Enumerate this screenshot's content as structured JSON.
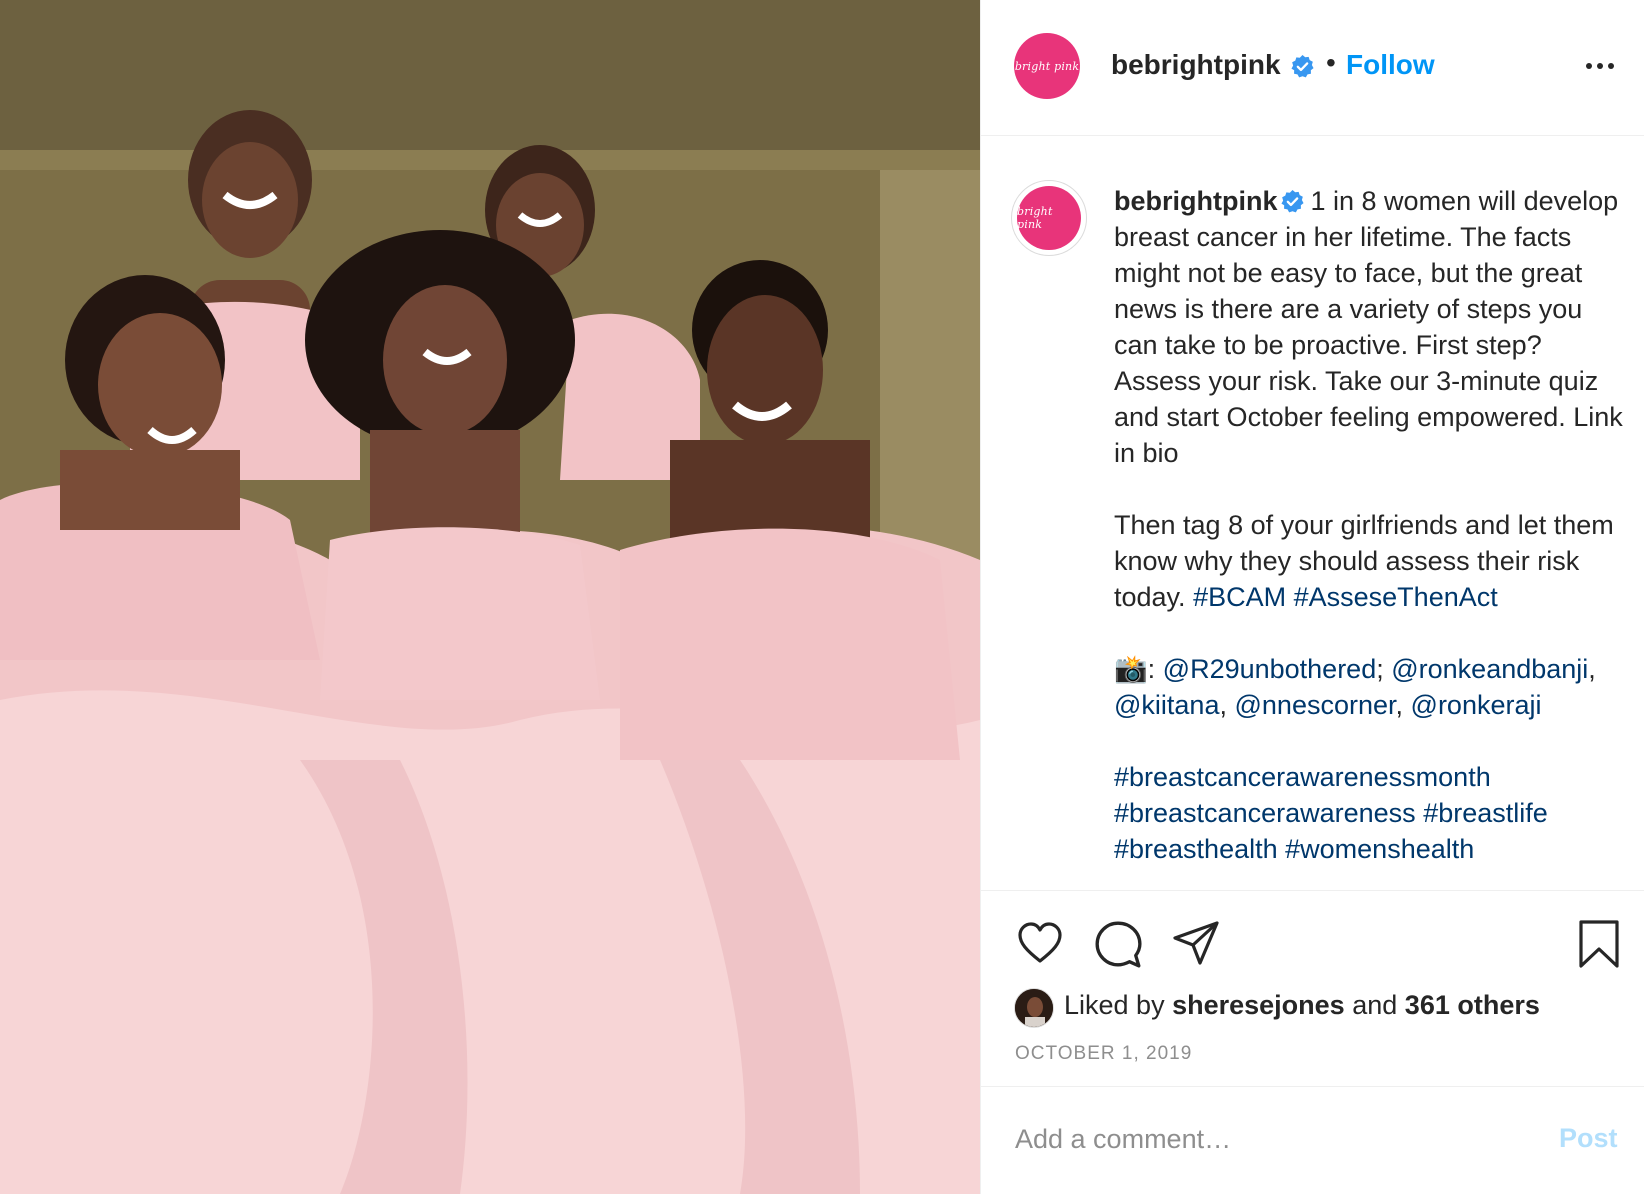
{
  "photo": {
    "alt_icon": "photo-image"
  },
  "header": {
    "avatar_text": "bright pink",
    "username": "bebrightpink",
    "separator": "•",
    "follow_label": "Follow",
    "more_icon": "more-options-icon"
  },
  "caption": {
    "avatar_text": "bright pink",
    "username": "bebrightpink",
    "paragraph1": "1 in 8 women will develop breast cancer in her lifetime. The facts might not be easy to face, but the great news is there are a variety of steps you can take to be proactive. First step? Assess your risk. Take our 3-minute quiz and start October feeling empowered. Link in bio",
    "paragraph2": "Then tag 8 of your girlfriends and let them know why they should assess their risk today.",
    "hashtag_bcam": "#BCAM",
    "hashtag_assess": "#AsseseThenAct",
    "camera_emoji": "📸",
    "credit_colon": ":",
    "mention1": "@R29unbothered",
    "mention_sep1": ";",
    "mention2": "@ronkeandbanji",
    "mention_sep2": ",",
    "mention3": "@kiitana",
    "mention_sep3": ",",
    "mention4": "@nnescorner",
    "mention_sep4": ",",
    "mention5": "@ronkeraji",
    "hashtag1": "#breastcancerawarenessmonth",
    "hashtag2": "#breastcancerawareness",
    "hashtag3": "#breastlife",
    "hashtag4": "#breasthealth",
    "hashtag5": "#womenshealth"
  },
  "actions": {
    "liked_prefix": "Liked by",
    "liked_user": "sheresejones",
    "liked_and": "and",
    "liked_others": "361 others",
    "date": "OCTOBER 1, 2019"
  },
  "comment": {
    "placeholder": "Add a comment…",
    "post_label": "Post"
  },
  "colors": {
    "brand_pink": "#e8347a",
    "link_blue": "#0095f6",
    "hashtag_blue": "#00376b",
    "verified_blue": "#3897f0"
  }
}
